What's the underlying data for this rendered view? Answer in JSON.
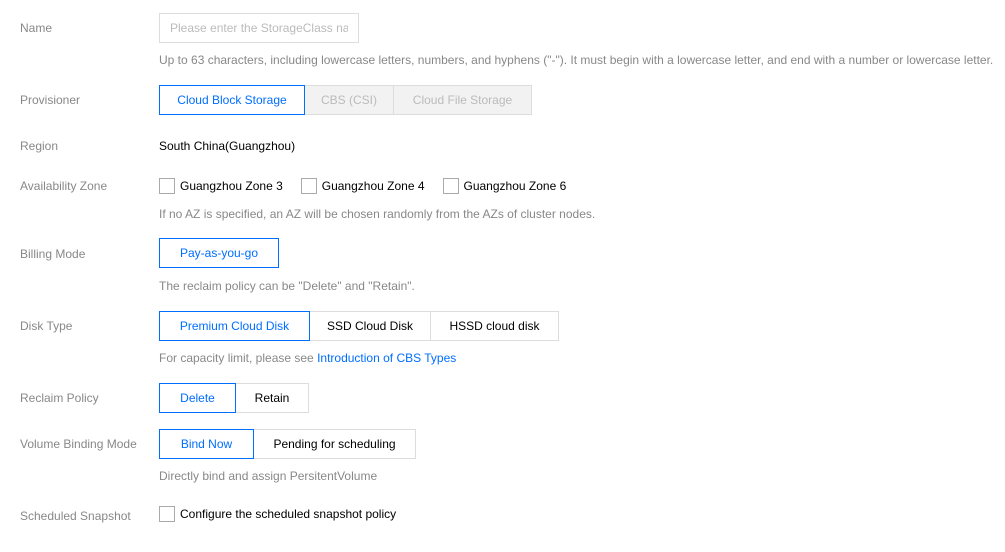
{
  "form": {
    "name": {
      "label": "Name",
      "placeholder": "Please enter the StorageClass nan",
      "value": "",
      "help": "Up to 63 characters, including lowercase letters, numbers, and hyphens (\"-\"). It must begin with a lowercase letter, and end with a number or lowercase letter."
    },
    "provisioner": {
      "label": "Provisioner",
      "options": [
        "Cloud Block Storage",
        "CBS (CSI)",
        "Cloud File Storage"
      ],
      "selected": "Cloud Block Storage",
      "disabled": [
        "CBS (CSI)",
        "Cloud File Storage"
      ]
    },
    "region": {
      "label": "Region",
      "value": "South China(Guangzhou)"
    },
    "availability_zone": {
      "label": "Availability Zone",
      "options": [
        {
          "label": "Guangzhou Zone 3",
          "checked": false
        },
        {
          "label": "Guangzhou Zone 4",
          "checked": false
        },
        {
          "label": "Guangzhou Zone 6",
          "checked": false
        }
      ],
      "help": "If no AZ is specified, an AZ will be chosen randomly from the AZs of cluster nodes."
    },
    "billing_mode": {
      "label": "Billing Mode",
      "options": [
        "Pay-as-you-go"
      ],
      "selected": "Pay-as-you-go",
      "help": "The reclaim policy can be \"Delete\" and \"Retain\"."
    },
    "disk_type": {
      "label": "Disk Type",
      "options": [
        "Premium Cloud Disk",
        "SSD Cloud Disk",
        "HSSD cloud disk"
      ],
      "selected": "Premium Cloud Disk",
      "help_prefix": "For capacity limit, please see ",
      "help_link": "Introduction of CBS Types"
    },
    "reclaim_policy": {
      "label": "Reclaim Policy",
      "options": [
        "Delete",
        "Retain"
      ],
      "selected": "Delete"
    },
    "volume_binding_mode": {
      "label": "Volume Binding Mode",
      "options": [
        "Bind Now",
        "Pending for scheduling"
      ],
      "selected": "Bind Now",
      "help": "Directly bind and assign PersitentVolume"
    },
    "scheduled_snapshot": {
      "label": "Scheduled Snapshot",
      "checkbox_label": "Configure the scheduled snapshot policy",
      "checked": false
    }
  },
  "colors": {
    "accent": "#006eff",
    "label": "#888888",
    "border": "#dddddd",
    "disabled_bg": "#f2f2f2",
    "disabled_text": "#bbbbbb"
  }
}
